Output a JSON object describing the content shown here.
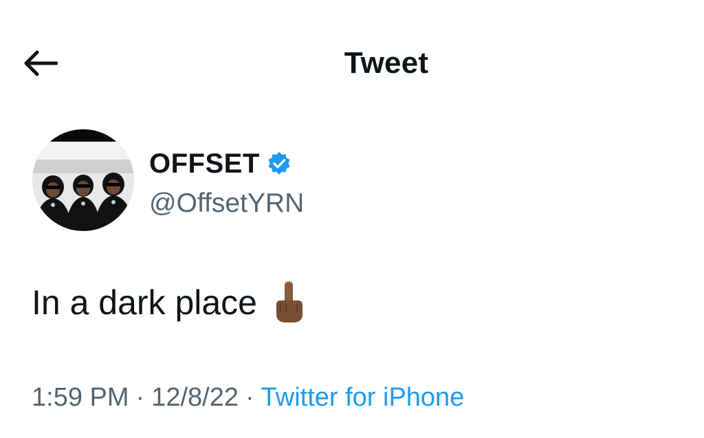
{
  "header": {
    "back_icon": "arrow-left-icon",
    "title": "Tweet"
  },
  "tweet": {
    "author": {
      "avatar": "group-photo-avatar",
      "name": "OFFSET",
      "verified": true,
      "verified_icon": "verified-badge-icon",
      "verified_color": "#1d9bf0",
      "handle": "@OffsetYRN"
    },
    "text": "In a dark place",
    "emoji_icon": "middle-finger-emoji-icon",
    "meta": {
      "time": "1:59 PM",
      "separator": "·",
      "date": "12/8/22",
      "source": "Twitter for iPhone",
      "source_color": "#1d9bf0"
    }
  }
}
